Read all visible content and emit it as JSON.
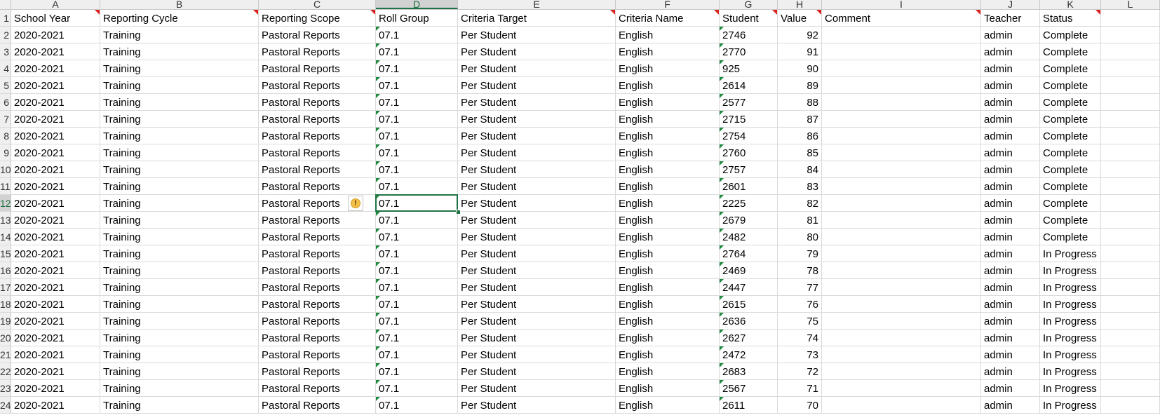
{
  "spreadsheet": {
    "column_letters": [
      "A",
      "B",
      "C",
      "D",
      "E",
      "F",
      "G",
      "H",
      "I",
      "J",
      "K",
      "L"
    ],
    "selected_column": "D",
    "row_numbers": [
      "1",
      "2",
      "3",
      "4",
      "5",
      "6",
      "7",
      "8",
      "9",
      "10",
      "11",
      "12",
      "13",
      "14",
      "15",
      "16",
      "17",
      "18",
      "19",
      "20",
      "21",
      "22",
      "23",
      "24"
    ],
    "selected_row": "12",
    "headers": [
      "School Year",
      "Reporting Cycle",
      "Reporting Scope",
      "Roll Group",
      "Criteria Target",
      "Criteria Name",
      "Student",
      "Value",
      "Comment",
      "Teacher",
      "Status"
    ],
    "rows": [
      [
        "2020-2021",
        "Training",
        "Pastoral Reports",
        "07.1",
        "Per Student",
        "English",
        "2746",
        "92",
        "",
        "admin",
        "Complete"
      ],
      [
        "2020-2021",
        "Training",
        "Pastoral Reports",
        "07.1",
        "Per Student",
        "English",
        "2770",
        "91",
        "",
        "admin",
        "Complete"
      ],
      [
        "2020-2021",
        "Training",
        "Pastoral Reports",
        "07.1",
        "Per Student",
        "English",
        "925",
        "90",
        "",
        "admin",
        "Complete"
      ],
      [
        "2020-2021",
        "Training",
        "Pastoral Reports",
        "07.1",
        "Per Student",
        "English",
        "2614",
        "89",
        "",
        "admin",
        "Complete"
      ],
      [
        "2020-2021",
        "Training",
        "Pastoral Reports",
        "07.1",
        "Per Student",
        "English",
        "2577",
        "88",
        "",
        "admin",
        "Complete"
      ],
      [
        "2020-2021",
        "Training",
        "Pastoral Reports",
        "07.1",
        "Per Student",
        "English",
        "2715",
        "87",
        "",
        "admin",
        "Complete"
      ],
      [
        "2020-2021",
        "Training",
        "Pastoral Reports",
        "07.1",
        "Per Student",
        "English",
        "2754",
        "86",
        "",
        "admin",
        "Complete"
      ],
      [
        "2020-2021",
        "Training",
        "Pastoral Reports",
        "07.1",
        "Per Student",
        "English",
        "2760",
        "85",
        "",
        "admin",
        "Complete"
      ],
      [
        "2020-2021",
        "Training",
        "Pastoral Reports",
        "07.1",
        "Per Student",
        "English",
        "2757",
        "84",
        "",
        "admin",
        "Complete"
      ],
      [
        "2020-2021",
        "Training",
        "Pastoral Reports",
        "07.1",
        "Per Student",
        "English",
        "2601",
        "83",
        "",
        "admin",
        "Complete"
      ],
      [
        "2020-2021",
        "Training",
        "Pastoral Reports",
        "07.1",
        "Per Student",
        "English",
        "2225",
        "82",
        "",
        "admin",
        "Complete"
      ],
      [
        "2020-2021",
        "Training",
        "Pastoral Reports",
        "07.1",
        "Per Student",
        "English",
        "2679",
        "81",
        "",
        "admin",
        "Complete"
      ],
      [
        "2020-2021",
        "Training",
        "Pastoral Reports",
        "07.1",
        "Per Student",
        "English",
        "2482",
        "80",
        "",
        "admin",
        "Complete"
      ],
      [
        "2020-2021",
        "Training",
        "Pastoral Reports",
        "07.1",
        "Per Student",
        "English",
        "2764",
        "79",
        "",
        "admin",
        "In Progress"
      ],
      [
        "2020-2021",
        "Training",
        "Pastoral Reports",
        "07.1",
        "Per Student",
        "English",
        "2469",
        "78",
        "",
        "admin",
        "In Progress"
      ],
      [
        "2020-2021",
        "Training",
        "Pastoral Reports",
        "07.1",
        "Per Student",
        "English",
        "2447",
        "77",
        "",
        "admin",
        "In Progress"
      ],
      [
        "2020-2021",
        "Training",
        "Pastoral Reports",
        "07.1",
        "Per Student",
        "English",
        "2615",
        "76",
        "",
        "admin",
        "In Progress"
      ],
      [
        "2020-2021",
        "Training",
        "Pastoral Reports",
        "07.1",
        "Per Student",
        "English",
        "2636",
        "75",
        "",
        "admin",
        "In Progress"
      ],
      [
        "2020-2021",
        "Training",
        "Pastoral Reports",
        "07.1",
        "Per Student",
        "English",
        "2627",
        "74",
        "",
        "admin",
        "In Progress"
      ],
      [
        "2020-2021",
        "Training",
        "Pastoral Reports",
        "07.1",
        "Per Student",
        "English",
        "2472",
        "73",
        "",
        "admin",
        "In Progress"
      ],
      [
        "2020-2021",
        "Training",
        "Pastoral Reports",
        "07.1",
        "Per Student",
        "English",
        "2683",
        "72",
        "",
        "admin",
        "In Progress"
      ],
      [
        "2020-2021",
        "Training",
        "Pastoral Reports",
        "07.1",
        "Per Student",
        "English",
        "2567",
        "71",
        "",
        "admin",
        "In Progress"
      ],
      [
        "2020-2021",
        "Training",
        "Pastoral Reports",
        "07.1",
        "Per Student",
        "English",
        "2611",
        "70",
        "",
        "admin",
        "In Progress"
      ]
    ],
    "warning_icon_glyph": "!",
    "icons": {
      "error_warning": "warning-icon",
      "comment_indicator": "red-triangle",
      "number_as_text_indicator": "green-triangle"
    },
    "colors": {
      "accent": "#217346",
      "comment_marker": "#e0201b",
      "error_marker": "#1e8a3e",
      "warning": "#f3c14b"
    }
  }
}
